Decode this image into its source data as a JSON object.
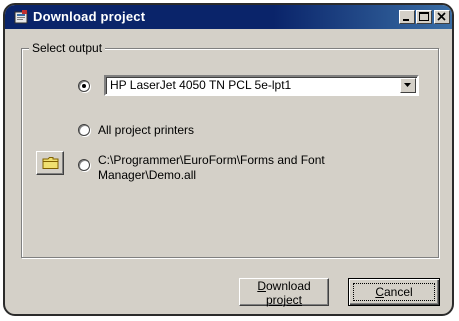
{
  "window": {
    "title": "Download project",
    "icon": "app-icon",
    "controls": [
      "minimize-icon",
      "maximize-icon",
      "close-icon"
    ]
  },
  "group": {
    "label": "Select output"
  },
  "options": [
    {
      "kind": "printer",
      "selected": true,
      "combo_value": "HP LaserJet 4050 TN PCL 5e-lpt1"
    },
    {
      "kind": "all-printers",
      "selected": false,
      "label": "All project printers"
    },
    {
      "kind": "file",
      "selected": false,
      "label_line1": "C:\\Programmer\\EuroForm\\Forms and Font",
      "label_line2": "Manager\\Demo.all",
      "browse_icon": "folder-icon"
    }
  ],
  "buttons": {
    "download": {
      "line1_first": "D",
      "line1_rest": "ownload",
      "line2_first": "p",
      "line2_rest": "roject"
    },
    "cancel": {
      "first": "C",
      "rest": "ancel"
    }
  },
  "colors": {
    "face": "#d4d0c8",
    "titlebar": "#0a246a",
    "title_text": "#ffffff"
  }
}
